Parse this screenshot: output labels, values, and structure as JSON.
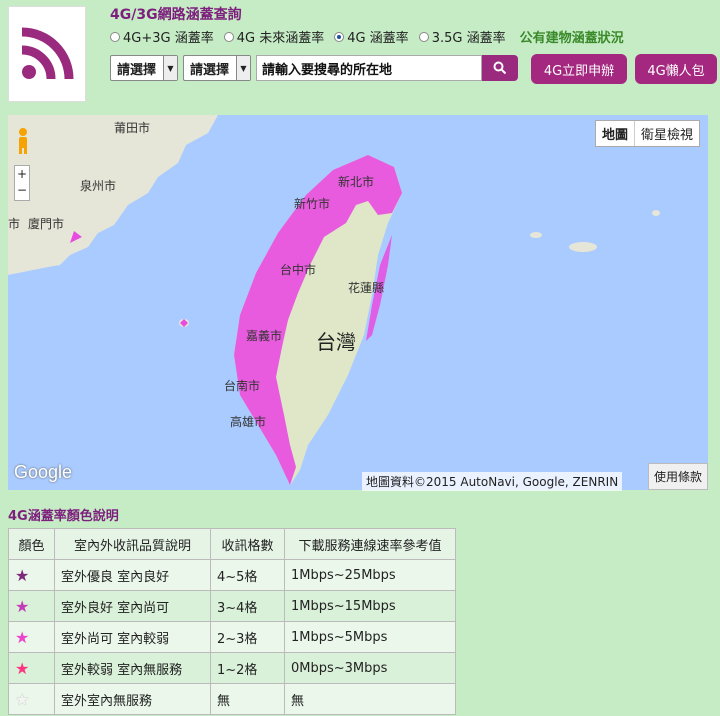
{
  "header": {
    "title": "4G/3G網路涵蓋查詢",
    "radios": [
      {
        "label": "4G+3G 涵蓋率",
        "checked": false
      },
      {
        "label": "4G 未來涵蓋率",
        "checked": false
      },
      {
        "label": "4G 涵蓋率",
        "checked": true
      },
      {
        "label": "3.5G 涵蓋率",
        "checked": false
      }
    ],
    "public_building_link": "公有建物涵蓋狀況"
  },
  "search": {
    "select1": "請選擇",
    "select2": "請選擇",
    "placeholder": "請輸入要搜尋的所在地",
    "apply_button": "4G立即申辦",
    "lazy_pack_button": "4G懶人包"
  },
  "map": {
    "type_map": "地圖",
    "type_satellite": "衛星檢視",
    "zoom_in": "+",
    "zoom_out": "−",
    "labels": {
      "putian": "莆田市",
      "quanzhou": "泉州市",
      "xiamen": "廈門市",
      "xiamen_partial": "市",
      "xinbei": "新北市",
      "xinzhu": "新竹市",
      "taizhong": "台中市",
      "hualian": "花蓮縣",
      "jiayi": "嘉義市",
      "tainan": "台南市",
      "gaoxiong": "高雄市",
      "taiwan": "台灣"
    },
    "google": "Google",
    "attribution": "地圖資料©2015 AutoNavi, Google, ZENRIN",
    "terms": "使用條款",
    "colors": {
      "coverage": "#e94be0",
      "land": "#dfe7c8",
      "sea": "#aacbff"
    }
  },
  "legend": {
    "title": "4G涵蓋率顏色說明",
    "headers": [
      "顏色",
      "室內外收訊品質說明",
      "收訊格數",
      "下載服務連線速率參考值"
    ],
    "rows": [
      {
        "color": "#7d2a7d",
        "desc": "室外優良 室內良好",
        "bars": "4~5格",
        "speed": "1Mbps~25Mbps"
      },
      {
        "color": "#c43ab8",
        "desc": "室外良好 室內尚可",
        "bars": "3~4格",
        "speed": "1Mbps~15Mbps"
      },
      {
        "color": "#ee44cc",
        "desc": "室外尚可 室內較弱",
        "bars": "2~3格",
        "speed": "1Mbps~5Mbps"
      },
      {
        "color": "#ff3380",
        "desc": "室外較弱 室內無服務",
        "bars": "1~2格",
        "speed": "0Mbps~3Mbps"
      },
      {
        "color": "#f4f4f4",
        "desc": "室外室內無服務",
        "bars": "無",
        "speed": "無"
      }
    ]
  }
}
